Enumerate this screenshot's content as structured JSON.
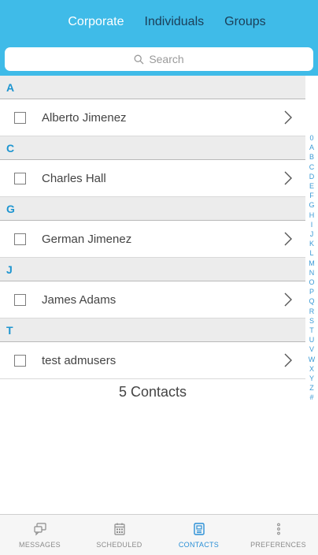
{
  "header": {
    "tabs": [
      {
        "label": "Corporate",
        "active": true
      },
      {
        "label": "Individuals",
        "active": false
      },
      {
        "label": "Groups",
        "active": false
      }
    ]
  },
  "search": {
    "placeholder": "Search"
  },
  "sections": [
    {
      "letter": "A",
      "contacts": [
        "Alberto Jimenez"
      ]
    },
    {
      "letter": "C",
      "contacts": [
        "Charles Hall"
      ]
    },
    {
      "letter": "G",
      "contacts": [
        "German Jimenez"
      ]
    },
    {
      "letter": "J",
      "contacts": [
        "James Adams"
      ]
    },
    {
      "letter": "T",
      "contacts": [
        "test admusers"
      ]
    }
  ],
  "footer_count": "5 Contacts",
  "index_letters": [
    "0",
    "A",
    "B",
    "C",
    "D",
    "E",
    "F",
    "G",
    "H",
    "I",
    "J",
    "K",
    "L",
    "M",
    "N",
    "O",
    "P",
    "Q",
    "R",
    "S",
    "T",
    "U",
    "V",
    "W",
    "X",
    "Y",
    "Z",
    "#"
  ],
  "tabbar": {
    "items": [
      {
        "label": "MESSAGES",
        "icon": "messages-icon",
        "active": false
      },
      {
        "label": "SCHEDULED",
        "icon": "calendar-icon",
        "active": false
      },
      {
        "label": "CONTACTS",
        "icon": "contacts-icon",
        "active": true
      },
      {
        "label": "PREFERENCES",
        "icon": "more-dots-icon",
        "active": false
      }
    ]
  },
  "colors": {
    "accent": "#3fbbe8",
    "section_text": "#1d95d0",
    "active_tab": "#2a8fd6"
  }
}
